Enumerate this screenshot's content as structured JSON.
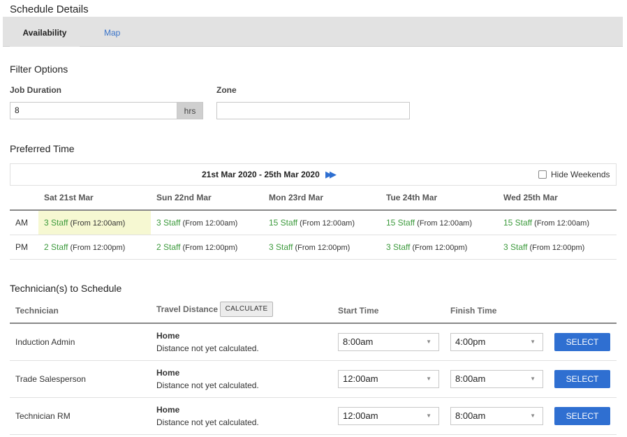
{
  "page_title": "Schedule Details",
  "tabs": [
    {
      "label": "Availability",
      "active": true
    },
    {
      "label": "Map",
      "active": false
    }
  ],
  "filter": {
    "title": "Filter Options",
    "job_duration_label": "Job Duration",
    "job_duration_value": "8",
    "job_duration_unit": "hrs",
    "zone_label": "Zone",
    "zone_value": ""
  },
  "preferred_time": {
    "title": "Preferred Time",
    "range": "21st Mar 2020 - 25th Mar 2020",
    "hide_weekends_label": "Hide Weekends",
    "hide_weekends_checked": false,
    "days": [
      "Sat 21st Mar",
      "Sun 22nd Mar",
      "Mon 23rd Mar",
      "Tue 24th Mar",
      "Wed 25th Mar"
    ],
    "rows": [
      {
        "label": "AM",
        "slots": [
          {
            "staff": "3 Staff",
            "from": "(From 12:00am)"
          },
          {
            "staff": "3 Staff",
            "from": "(From 12:00am)"
          },
          {
            "staff": "15 Staff",
            "from": "(From 12:00am)"
          },
          {
            "staff": "15 Staff",
            "from": "(From 12:00am)"
          },
          {
            "staff": "15 Staff",
            "from": "(From 12:00am)"
          }
        ]
      },
      {
        "label": "PM",
        "slots": [
          {
            "staff": "2 Staff",
            "from": "(From 12:00pm)"
          },
          {
            "staff": "2 Staff",
            "from": "(From 12:00pm)"
          },
          {
            "staff": "3 Staff",
            "from": "(From 12:00pm)"
          },
          {
            "staff": "3 Staff",
            "from": "(From 12:00pm)"
          },
          {
            "staff": "3 Staff",
            "from": "(From 12:00pm)"
          }
        ]
      }
    ]
  },
  "technicians": {
    "title": "Technician(s) to Schedule",
    "headers": {
      "technician": "Technician",
      "travel_distance": "Travel Distance",
      "calculate": "CALCULATE",
      "start_time": "Start Time",
      "finish_time": "Finish Time"
    },
    "rows": [
      {
        "name": "Induction Admin",
        "location": "Home",
        "distance": "Distance not yet calculated.",
        "start": "8:00am",
        "finish": "4:00pm",
        "action": "SELECT"
      },
      {
        "name": "Trade Salesperson",
        "location": "Home",
        "distance": "Distance not yet calculated.",
        "start": "12:00am",
        "finish": "8:00am",
        "action": "SELECT"
      },
      {
        "name": "Technician RM",
        "location": "Home",
        "distance": "Distance not yet calculated.",
        "start": "12:00am",
        "finish": "8:00am",
        "action": "SELECT"
      }
    ]
  },
  "colors": {
    "accent": "#2f6fd1",
    "staff_green": "#3c9a3c",
    "highlight": "#f6f8d2",
    "tab_bg": "#e2e2e2"
  }
}
